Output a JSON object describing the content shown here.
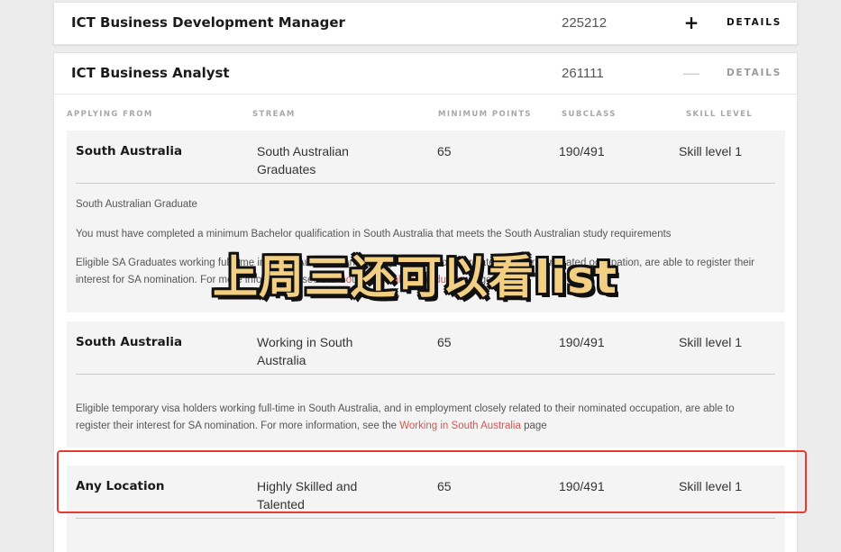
{
  "occupations": [
    {
      "title": "ICT Business Development Manager",
      "code": "225212",
      "toggle": "+",
      "details": "DETAILS"
    },
    {
      "title": "ICT Business Analyst",
      "code": "261111",
      "toggle": "—",
      "details": "DETAILS"
    }
  ],
  "table": {
    "headers": [
      "APPLYING FROM",
      "STREAM",
      "MINIMUM POINTS",
      "SUBCLASS",
      "SKILL LEVEL"
    ],
    "rows": [
      {
        "location": "South Australia",
        "stream": "South Australian Graduates",
        "points": "65",
        "subclass": "190/491",
        "skill_level": "Skill level 1",
        "para1": "South Australian Graduate",
        "para2": "You must have completed a minimum Bachelor qualification in South Australia that meets the South Australian study requirements",
        "para3_a": "Eligible SA Graduates working full-time in South Australia, and in employment closely related to their nominated occupation, are able to register their interest for SA nomination. For more information, see the ",
        "para3_link": "South Australian Graduates",
        "para3_b": " page"
      },
      {
        "location": "South Australia",
        "stream": "Working in South Australia",
        "points": "65",
        "subclass": "190/491",
        "skill_level": "Skill level 1",
        "para_a": "Eligible temporary visa holders working full-time in South Australia, and in employment closely related to their nominated occupation, are able to register their interest for SA nomination. For more information, see the ",
        "para_link": "Working in South Australia",
        "para_b": " page"
      },
      {
        "location": "Any Location",
        "stream": "Highly Skilled and Talented",
        "points": "65",
        "subclass": "190/491",
        "skill_level": "Skill level 1"
      }
    ]
  },
  "overlay_text": "上周三还可以看list",
  "colors": {
    "highlight": "#e83b2e",
    "link": "#d9534f",
    "overlay_fill": "#f2cf83"
  }
}
